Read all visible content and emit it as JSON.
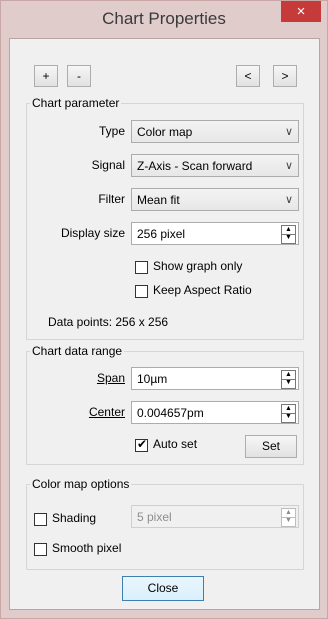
{
  "window": {
    "title": "Chart Properties",
    "close_glyph": "×"
  },
  "toolbar": {
    "add_label": "+",
    "remove_label": "-",
    "prev_label": "<",
    "next_label": ">"
  },
  "chart_parameter": {
    "group_title": "Chart parameter",
    "type_label": "Type",
    "type_value": "Color map",
    "signal_label": "Signal",
    "signal_value": "Z-Axis - Scan forward",
    "filter_label": "Filter",
    "filter_value": "Mean fit",
    "display_size_label": "Display size",
    "display_size_value": "256 pixel",
    "show_graph_only_label": "Show graph only",
    "show_graph_only_checked": false,
    "keep_aspect_label": "Keep Aspect Ratio",
    "keep_aspect_checked": false,
    "data_points_text": "Data points: 256 x 256"
  },
  "data_range": {
    "group_title": "Chart data range",
    "span_label": "Span",
    "span_value": "10µm",
    "center_label": "Center",
    "center_value": "0.004657pm",
    "auto_set_label": "Auto set",
    "auto_set_checked": true,
    "set_button_label": "Set"
  },
  "color_map": {
    "group_title": "Color map options",
    "shading_label": "Shading",
    "shading_checked": false,
    "shading_value": "5 pixel",
    "smooth_pixel_label": "Smooth pixel",
    "smooth_pixel_checked": false
  },
  "footer": {
    "close_label": "Close"
  },
  "colors": {
    "titlebar": "#e1cccc",
    "close_button": "#c73a3a",
    "dialog_bg": "#f0f0f0",
    "focus_border": "#3c7fb1"
  }
}
